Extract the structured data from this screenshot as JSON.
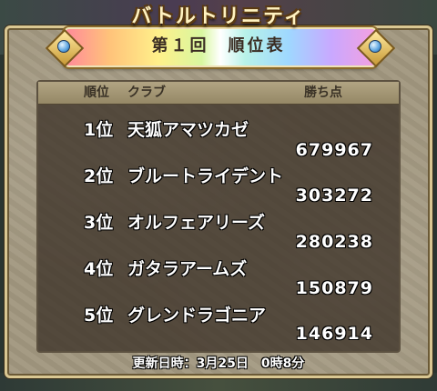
{
  "game_title": "バトルトリニティ",
  "round_title": "第１回　順位表",
  "table": {
    "headers": {
      "rank": "順位",
      "club": "クラブ",
      "points": "勝ち点"
    },
    "rows": [
      {
        "rank": "1位",
        "club": "天狐アマツカゼ",
        "points": "679967"
      },
      {
        "rank": "2位",
        "club": "ブルートライデント",
        "points": "303272"
      },
      {
        "rank": "3位",
        "club": "オルフェアリーズ",
        "points": "280238"
      },
      {
        "rank": "4位",
        "club": "ガタラアームズ",
        "points": "150879"
      },
      {
        "rank": "5位",
        "club": "グレンドラゴニア",
        "points": "146914"
      }
    ]
  },
  "footer": {
    "updated": "更新日時：3月25日　0時8分"
  },
  "colors": {
    "frame_gold": "#d9c792",
    "panel_bg": "#a29880",
    "table_bg": "#3c3228",
    "text_white": "#ffffff"
  }
}
